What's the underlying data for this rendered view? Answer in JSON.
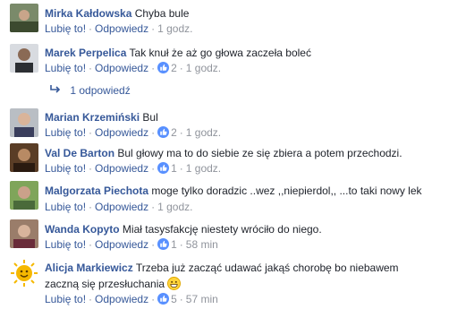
{
  "actions": {
    "like": "Lubię to!",
    "reply": "Odpowiedz"
  },
  "comments": [
    {
      "author": "Mirka Kałdowska",
      "text": "Chyba bule",
      "time": "1 godz.",
      "reactions": ""
    },
    {
      "author": "Marek Perpelica",
      "text": "Tak knuł że aż go głowa zaczeła boleć",
      "time": "1 godz.",
      "reactions": "2",
      "replies": "1 odpowiedź"
    },
    {
      "author": "Marian Krzemiński",
      "text": "Bul",
      "time": "1 godz.",
      "reactions": "2"
    },
    {
      "author": "Val De Barton",
      "text": "Bul głowy ma to do siebie ze się zbiera a potem przechodzi.",
      "time": "1 godz.",
      "reactions": "1"
    },
    {
      "author": "Malgorzata Piechota",
      "text": "moge tylko doradzic ..wez ,,niepierdol,, ...to taki nowy lek",
      "time": "1 godz.",
      "reactions": ""
    },
    {
      "author": "Wanda Kopyto",
      "text": "Miał tasysfakcję niestety wróciło do niego.",
      "time": "58 min",
      "reactions": "1"
    },
    {
      "author": "Alicja Markiewicz",
      "text": "Trzeba już zacząć udawać jakąś chorobę bo niebawem",
      "text2": "zaczną się przesłuchania",
      "time": "57 min",
      "reactions": "5"
    }
  ],
  "colors": {
    "link": "#365899",
    "meta": "#90949c",
    "text": "#1d2129",
    "like_icon": "#5890ff"
  },
  "icons": {
    "like_reaction": "thumbs-up-icon",
    "reply_arrow": "reply-arrow-icon",
    "emoji": "grinning-emoji"
  }
}
